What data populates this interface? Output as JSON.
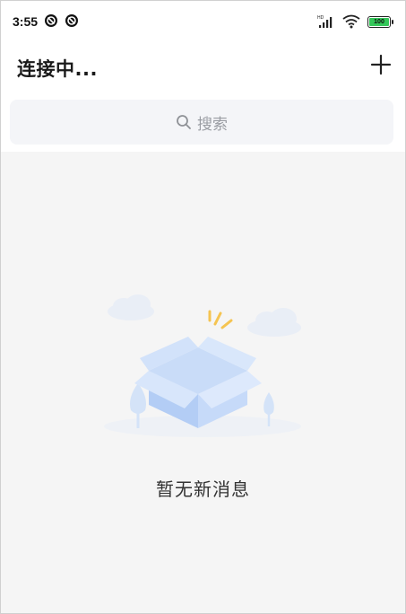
{
  "status_bar": {
    "time": "3:55",
    "battery_level": "100",
    "battery_color": "#34c759",
    "icons": [
      "app-notification-icon",
      "app-notification-icon",
      "hd-signal-icon",
      "wifi-icon",
      "battery-icon"
    ]
  },
  "header": {
    "title": "连接中...",
    "add_icon": "plus-icon"
  },
  "search": {
    "placeholder": "搜索",
    "icon": "search-icon"
  },
  "empty_state": {
    "message": "暂无新消息",
    "illustration": "empty-box-illustration"
  },
  "colors": {
    "background": "#f5f5f5",
    "search_bg": "#f4f5f8",
    "illustration_blue": "#b9d3f7"
  }
}
